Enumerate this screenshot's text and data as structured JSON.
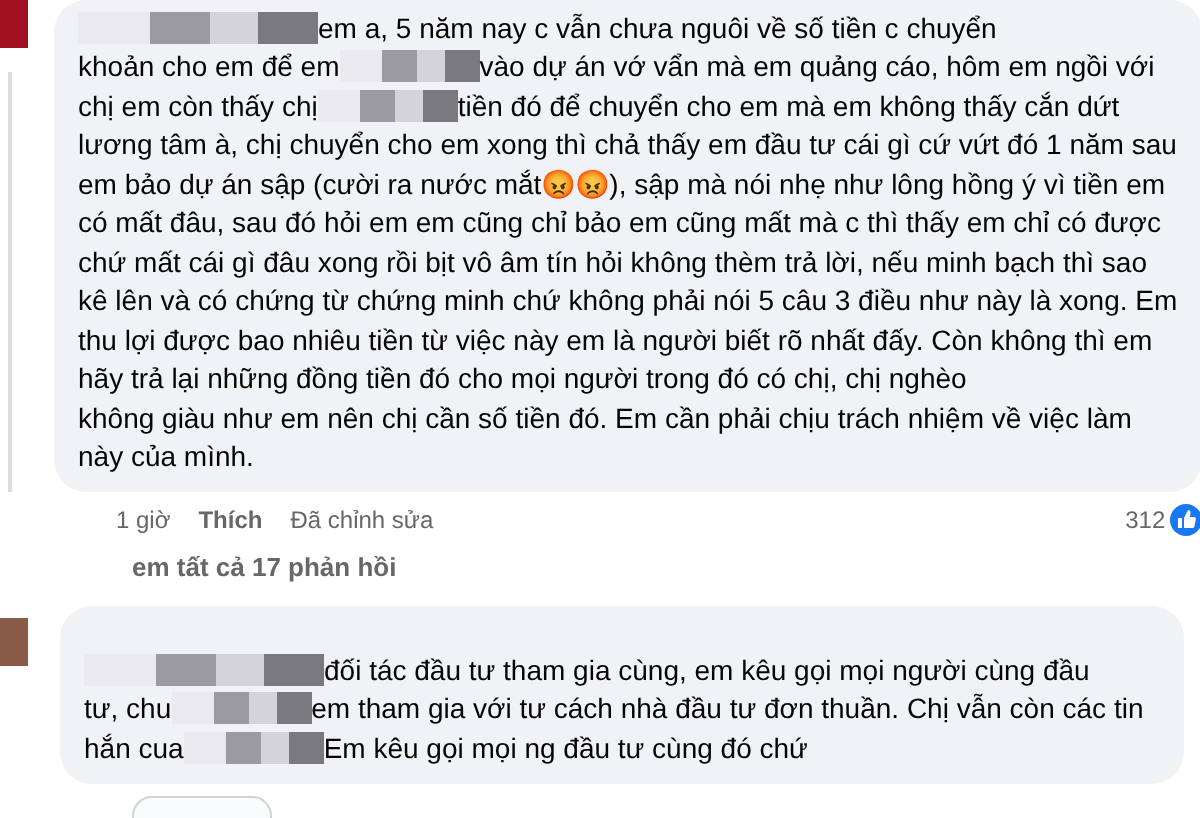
{
  "comments": [
    {
      "lines": [
        {
          "lead_mosaic": true,
          "parts": [
            "em a, 5 năm nay c vẫn chưa nguôi về số tiền c chuyển"
          ]
        },
        {
          "lead_mosaic": false,
          "parts": [
            "khoản cho em để em",
            "vào dự án vớ vẩn mà em quảng cáo, hôm em ngồi với"
          ]
        },
        {
          "lead_mosaic": false,
          "parts": [
            "chị em còn thấy chị",
            "tiền đó để chuyển cho em mà em không thấy cắn dứt"
          ]
        },
        {
          "lead_mosaic": false,
          "parts": [
            "lương tâm à, chị chuyển cho em xong thì chả thấy em đầu tư cái gì cứ vứt đó 1 năm sau"
          ]
        },
        {
          "lead_mosaic": false,
          "parts": [
            "em bảo dự án sập (cười ra nước mắt😡😡), sập mà nói nhẹ như lông hồng ý vì tiền em"
          ]
        },
        {
          "lead_mosaic": false,
          "parts": [
            "có mất đâu, sau đó hỏi em em cũng chỉ bảo em cũng mất mà c thì thấy em chỉ có được"
          ]
        },
        {
          "lead_mosaic": false,
          "parts": [
            "chứ mất cái gì đâu xong rồi bịt vô âm tín hỏi không thèm trả lời, nếu minh bạch thì sao"
          ]
        },
        {
          "lead_mosaic": false,
          "parts": [
            "kê lên và có chứng từ chứng minh chứ không phải nói 5 câu 3 điều như này là xong. Em"
          ]
        },
        {
          "lead_mosaic": false,
          "parts": [
            "thu lợi được bao nhiêu tiền từ việc này em là người biết rõ nhất đấy. Còn không thì em"
          ]
        },
        {
          "lead_mosaic": false,
          "parts": [
            "hãy trả lại những đồng tiền đó cho mọi người trong đó có chị, chị nghèo"
          ]
        },
        {
          "lead_mosaic": false,
          "parts": [
            "không giàu như em nên chị cần số tiền đó. Em cần phải chịu trách nhiệm về việc làm"
          ]
        },
        {
          "lead_mosaic": false,
          "parts": [
            "này của mình."
          ]
        }
      ],
      "footer": {
        "time": "1 giờ",
        "like": "Thích",
        "edited": "Đã chỉnh sửa",
        "reactions": "312"
      },
      "replies_link": "em tất cả 17 phản hồi"
    },
    {
      "lines": [
        {
          "lead_mosaic": true,
          "parts": [
            "đối tác đầu tư tham gia cùng, em kêu gọi mọi người cùng đầu"
          ]
        },
        {
          "lead_mosaic": false,
          "parts": [
            "tư, chu",
            "em tham gia với tư cách nhà đầu tư đơn thuần. Chị vẫn còn các tin"
          ]
        },
        {
          "lead_mosaic": false,
          "parts": [
            "hắn cua",
            "Em kêu gọi mọi ng đầu tư cùng đó chứ"
          ]
        }
      ]
    }
  ]
}
